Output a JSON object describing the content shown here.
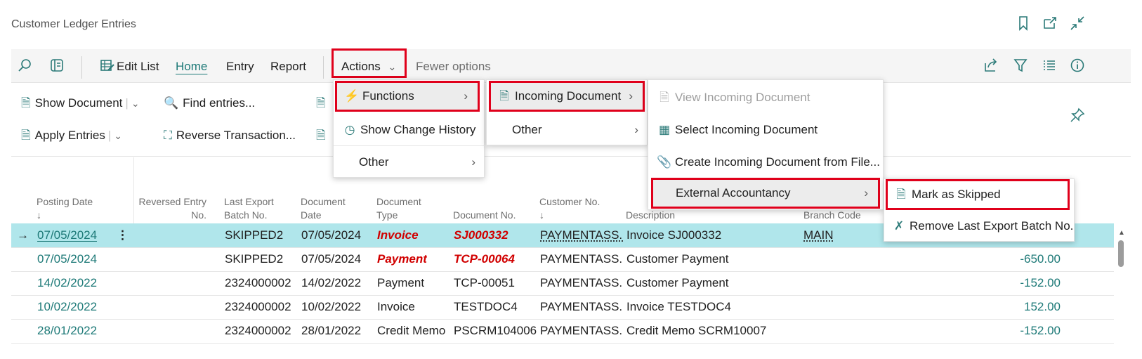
{
  "window": {
    "title": "Customer Ledger Entries",
    "icons": [
      "bookmark-icon",
      "open-new-window-icon",
      "collapse-icon"
    ]
  },
  "toolbar": {
    "edit_list": "Edit List",
    "home": "Home",
    "entry": "Entry",
    "report": "Report",
    "actions": "Actions",
    "fewer_options": "Fewer options"
  },
  "home_actions": {
    "show_document": "Show Document",
    "find_entries": "Find entries...",
    "apply_entries": "Apply Entries",
    "reverse_transaction": "Reverse Transaction..."
  },
  "menus": {
    "actions_menu": {
      "functions": "Functions",
      "show_change_history": "Show Change History",
      "other": "Other"
    },
    "functions_menu": {
      "incoming_document": "Incoming Document",
      "other": "Other"
    },
    "incoming_menu": {
      "view_incoming_document": "View Incoming Document",
      "select_incoming_document": "Select Incoming Document",
      "create_incoming_document": "Create Incoming Document from File...",
      "external_accountancy": "External Accountancy"
    },
    "external_menu": {
      "mark_as_skipped": "Mark as Skipped",
      "remove_last_export": "Remove Last Export Batch No."
    }
  },
  "columns": {
    "posting_date": "Posting Date",
    "reversed_entry_no_1": "Reversed Entry",
    "reversed_entry_no_2": "No.",
    "last_export_1": "Last Export",
    "last_export_2": "Batch No.",
    "document_date_1": "Document",
    "document_date_2": "Date",
    "document_type_1": "Document",
    "document_type_2": "Type",
    "document_no": "Document No.",
    "customer_no": "Customer No.",
    "description": "Description",
    "branch_code": "Branch Code",
    "sort_arrow": "↓"
  },
  "rows": [
    {
      "posting_date": "07/05/2024",
      "batch": "SKIPPED2",
      "doc_date": "07/05/2024",
      "doc_type": "Invoice",
      "doc_no": "SJ000332",
      "customer": "PAYMENTASS...",
      "description": "Invoice SJ000332",
      "branch": "MAIN",
      "amount": ""
    },
    {
      "posting_date": "07/05/2024",
      "batch": "SKIPPED2",
      "doc_date": "07/05/2024",
      "doc_type": "Payment",
      "doc_no": "TCP-00064",
      "customer": "PAYMENTASS...",
      "description": "Customer Payment",
      "branch": "",
      "amount": "-650.00"
    },
    {
      "posting_date": "14/02/2022",
      "batch": "2324000002",
      "doc_date": "14/02/2022",
      "doc_type": "Payment",
      "doc_no": "TCP-00051",
      "customer": "PAYMENTASS...",
      "description": "Customer Payment",
      "branch": "",
      "amount": "-152.00"
    },
    {
      "posting_date": "10/02/2022",
      "batch": "2324000002",
      "doc_date": "10/02/2022",
      "doc_type": "Invoice",
      "doc_no": "TESTDOC4",
      "customer": "PAYMENTASS...",
      "description": "Invoice TESTDOC4",
      "branch": "",
      "amount": "152.00"
    },
    {
      "posting_date": "28/01/2022",
      "batch": "2324000002",
      "doc_date": "28/01/2022",
      "doc_type": "Credit Memo",
      "doc_no": "PSCRM104006",
      "customer": "PAYMENTASS...",
      "description": "Credit Memo SCRM10007",
      "branch": "",
      "amount": "-152.00"
    }
  ],
  "colors": {
    "accent": "#1e7a78",
    "selected_row": "#b0e6eb",
    "highlight_red": "#e0001b",
    "emphasis_red": "#d10000"
  }
}
